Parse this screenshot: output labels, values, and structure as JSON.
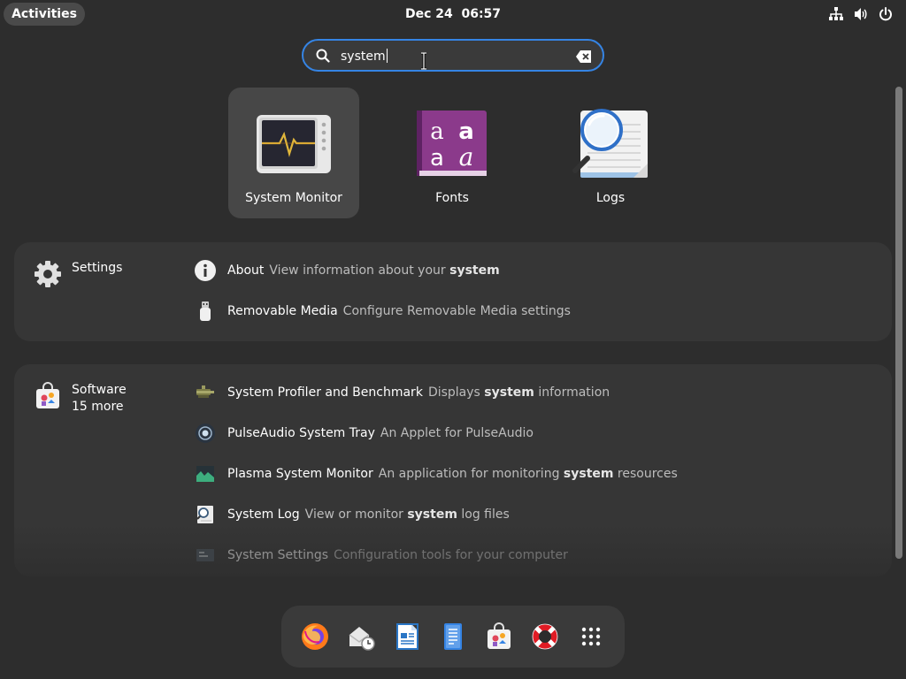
{
  "topbar": {
    "activities": "Activities",
    "clock": "Dec 24  06:57",
    "tray_icons": [
      "network-icon",
      "volume-icon",
      "power-icon"
    ]
  },
  "search": {
    "value": "system",
    "icon": "search-icon",
    "clear_icon": "clear-icon"
  },
  "apps": [
    {
      "label": "System Monitor",
      "icon": "system-monitor-icon",
      "selected": true
    },
    {
      "label": "Fonts",
      "icon": "fonts-icon"
    },
    {
      "label": "Logs",
      "icon": "logs-icon"
    }
  ],
  "settings_provider": {
    "name": "Settings",
    "results": [
      {
        "title": "About",
        "desc_pre": "View information about your ",
        "desc_bold": "system",
        "desc_post": ""
      },
      {
        "title": "Removable Media",
        "desc_pre": "Configure Removable Media settings",
        "desc_bold": "",
        "desc_post": ""
      }
    ]
  },
  "software_provider": {
    "name": "Software",
    "more": "15 more",
    "results": [
      {
        "title": "System Profiler and Benchmark",
        "desc_pre": "Displays ",
        "desc_bold": "system",
        "desc_post": " information"
      },
      {
        "title": "PulseAudio System Tray",
        "desc_pre": "An Applet for PulseAudio",
        "desc_bold": "",
        "desc_post": ""
      },
      {
        "title": "Plasma System Monitor",
        "desc_pre": "An application for monitoring ",
        "desc_bold": "system",
        "desc_post": " resources"
      },
      {
        "title": "System Log",
        "desc_pre": "View or monitor ",
        "desc_bold": "system",
        "desc_post": " log files"
      },
      {
        "title": "System Settings",
        "desc_pre": "Configuration tools for your computer",
        "desc_bold": "",
        "desc_post": ""
      }
    ]
  },
  "dash": {
    "items": [
      "firefox-icon",
      "evolution-mail-icon",
      "writer-icon",
      "text-editor-icon",
      "software-icon",
      "help-icon",
      "show-apps-icon"
    ]
  },
  "colors": {
    "accent": "#3584e4",
    "background": "#2d2d2d",
    "panel": "#363636"
  }
}
